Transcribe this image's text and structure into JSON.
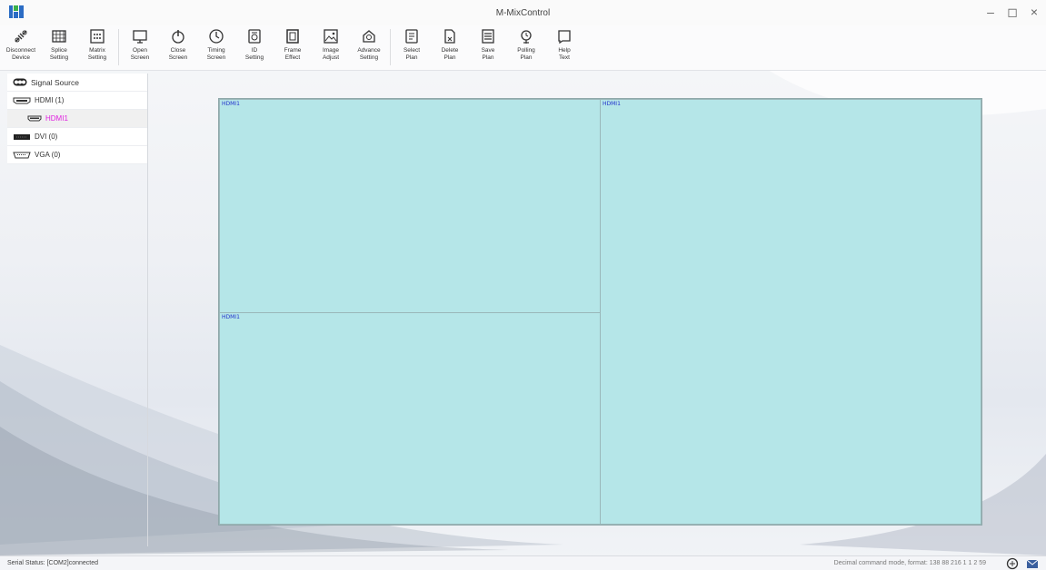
{
  "window": {
    "title": "M-MixControl",
    "controls": [
      "–",
      "◻",
      "×"
    ],
    "logo_icon": "app-logo-icon"
  },
  "toolbar": {
    "buttons": [
      {
        "label": "Disconnect\nDevice",
        "icon": "disconnect-icon"
      },
      {
        "label": "Splice\nSetting",
        "icon": "splice-icon"
      },
      {
        "label": "Matrix\nSetting",
        "icon": "matrix-icon"
      },
      {
        "label": "Open\nScreen",
        "icon": "monitor-icon"
      },
      {
        "label": "Close\nScreen",
        "icon": "power-icon"
      },
      {
        "label": "Timing\nScreen",
        "icon": "clock-icon"
      },
      {
        "label": "ID\nSetting",
        "icon": "id-icon"
      },
      {
        "label": "Frame\nEffect",
        "icon": "frame-icon"
      },
      {
        "label": "Image\nAdjust",
        "icon": "image-icon"
      },
      {
        "label": "Advance\nSetting",
        "icon": "advance-icon"
      },
      {
        "label": "Select\nPlan",
        "icon": "select-plan-icon"
      },
      {
        "label": "Delete\nPlan",
        "icon": "delete-plan-icon"
      },
      {
        "label": "Save\nPlan",
        "icon": "save-plan-icon"
      },
      {
        "label": "Polling\nPlan",
        "icon": "polling-icon"
      },
      {
        "label": "Help\nText",
        "icon": "help-icon"
      }
    ]
  },
  "signal_source": {
    "title": "Signal Source",
    "items": [
      {
        "label": "HDMI (1)"
      },
      {
        "label": "HDMI1",
        "selected": true
      },
      {
        "label": "DVI (0)"
      },
      {
        "label": "VGA (0)"
      }
    ]
  },
  "wall": {
    "windows": [
      {
        "label": "HDMI1"
      },
      {
        "label": "HDMI1"
      },
      {
        "label": "HDMI1"
      }
    ],
    "fill_color": "#b5e6e8",
    "label_color": "#2233cc"
  },
  "status": {
    "serial": "Serial Status: [COM2]connected",
    "mode": "Decimal command mode, format: 138 88 216 1 1 2 59",
    "icons": [
      "language-icon",
      "mail-icon"
    ]
  }
}
